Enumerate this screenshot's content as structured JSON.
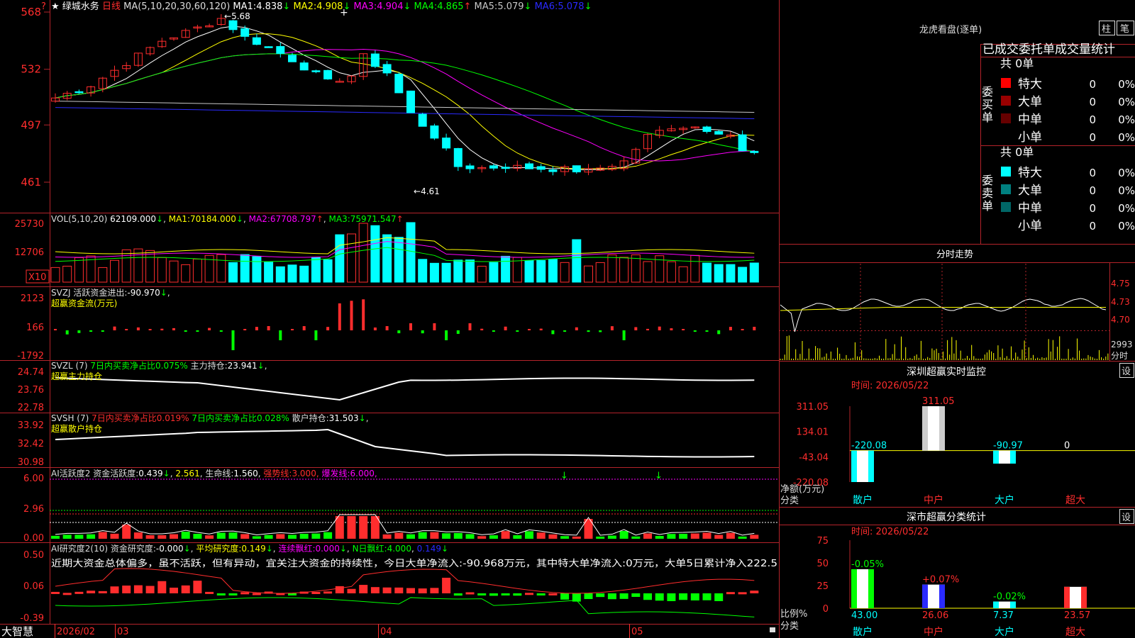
{
  "colors": {
    "up": "#ff2d2d",
    "down": "#00ffff",
    "ma1": "#ffffff",
    "ma2": "#ffff00",
    "ma3": "#ff00ff",
    "ma4": "#00ff00",
    "ma5": "#c8c8c8",
    "ma6": "#2a2aff",
    "axis": "#b4232a",
    "green": "#00ff00",
    "yellow": "#ffff00",
    "magenta": "#ff00ff"
  },
  "header": {
    "star": "★",
    "stock_name": "绿城水务",
    "period": "日线",
    "ma_params": "MA(5,10,20,30,60,120)",
    "ma": [
      {
        "label": "MA1:",
        "value": "4.838",
        "arrow": "↓"
      },
      {
        "label": "MA2:",
        "value": "4.908",
        "arrow": "↓"
      },
      {
        "label": "MA3:",
        "value": "4.904",
        "arrow": "↓"
      },
      {
        "label": "MA4:",
        "value": "4.865",
        "arrow": "↑"
      },
      {
        "label": "MA5:",
        "value": "5.079",
        "arrow": "↓"
      },
      {
        "label": "MA6:",
        "value": "5.078",
        "arrow": "↓"
      }
    ],
    "help": "?"
  },
  "main_axis": {
    "ticks": [
      "568",
      "532",
      "497",
      "461"
    ],
    "high_label": "5.68",
    "low_label": "4.61"
  },
  "vol": {
    "title": "VOL(5,10,20)",
    "value": "62109.000",
    "arrow": "↓",
    "ma": [
      {
        "label": "MA1:",
        "value": "70184.000",
        "arrow": "↓"
      },
      {
        "label": "MA2:",
        "value": "67708.797",
        "arrow": "↑"
      },
      {
        "label": "MA3:",
        "value": "75971.547",
        "arrow": "↑"
      }
    ],
    "ticks": [
      "25730",
      "12706"
    ],
    "unit": "X10"
  },
  "svzj": {
    "title": "SVZJ",
    "label": "活跃资金进出:",
    "value": "-90.970",
    "arrow": "↓",
    "subtitle": "超赢资金流(万元)",
    "ticks": [
      "2123",
      "166",
      "-1792"
    ]
  },
  "svzl": {
    "title": "SVZL (7)",
    "t1": "7日内买卖净占比0.075%",
    "t2": "主力持仓:",
    "value": "23.941",
    "arrow": "↓",
    "subtitle": "超赢主力持仓",
    "ticks": [
      "24.74",
      "23.76",
      "22.78"
    ]
  },
  "svsh": {
    "title": "SVSH (7)",
    "t1": "7日内买卖净占比0.019%",
    "t2": "7日内买卖净占比0.028%",
    "t3": "散户持仓:",
    "value": "31.503",
    "arrow": "↓",
    "subtitle": "超赢散户持仓",
    "ticks": [
      "33.92",
      "32.42",
      "30.98"
    ]
  },
  "ai_active": {
    "title": "AI活跃度2",
    "label": "资金活跃度:",
    "v1": "0.439",
    "a1": "↓",
    "v2": "2.561",
    "label2": "生命线:",
    "v3": "1.560",
    "strong": "强势线:",
    "v4": "3.000",
    "burst": "爆发线:",
    "v5": "6.000",
    "ticks": [
      "6.00",
      "2.96",
      "0.00"
    ]
  },
  "ai_research": {
    "title": "AI研究度2(10)",
    "l1": "资金研究度:",
    "v1": "-0.000",
    "a1": "↓",
    "l2": "平均研究度:",
    "v2": "0.149",
    "a2": "↓",
    "l3": "连续飘红:",
    "v3": "0.000",
    "a3": "↓",
    "l4": "N日飘红:",
    "v4": "4.000",
    "v5": "0.149",
    "a5": "↓",
    "commentary": "近期大资金总体偏多，虽不活跃，但有异动，宜关注大资金的持续性，今日大单净流入:-90.968万元，其中特大单净流入:0万元，大单5日累计净入222.5",
    "ticks": [
      "0.50",
      "0.06",
      "-0.39"
    ]
  },
  "time_axis": {
    "brand": "大智慧",
    "labels": [
      "2026/02",
      "03",
      "04",
      "05"
    ]
  },
  "right": {
    "lhkp_title": "龙虎看盘(逐单)",
    "tab_bar": "柱",
    "tab_brush": "笔",
    "stats_header": "已成交委托单成交量统计",
    "buy": {
      "side": "委买单",
      "total": "共 0单",
      "rows": [
        {
          "name": "特大",
          "count": "0",
          "pct": "0%",
          "color": "#ff0000"
        },
        {
          "name": "大单",
          "count": "0",
          "pct": "0%",
          "color": "#990000"
        },
        {
          "name": "中单",
          "count": "0",
          "pct": "0%",
          "color": "#660000"
        },
        {
          "name": "小单",
          "count": "0",
          "pct": "0%",
          "color": ""
        }
      ]
    },
    "sell": {
      "side": "委卖单",
      "total": "共 0单",
      "rows": [
        {
          "name": "特大",
          "count": "0",
          "pct": "0%",
          "color": "#00ffff"
        },
        {
          "name": "大单",
          "count": "0",
          "pct": "0%",
          "color": "#008080"
        },
        {
          "name": "中单",
          "count": "0",
          "pct": "0%",
          "color": "#006666"
        },
        {
          "name": "小单",
          "count": "0",
          "pct": "0%",
          "color": ""
        }
      ]
    },
    "intraday": {
      "title": "分时走势",
      "ticks": [
        "4.75",
        "4.73",
        "4.70"
      ],
      "vol_tick": "2993",
      "vol_label": "分时"
    },
    "monitor": {
      "title": "深圳超赢实时监控",
      "settings": "设",
      "time": "时间: 2026/05/22",
      "ticks": [
        "311.05",
        "134.01",
        "-43.04",
        "-220.08"
      ],
      "net_label": "净额(万元)",
      "cat_label": "分类",
      "bars": [
        {
          "name": "散户",
          "value": -220.08,
          "label": "-220.08",
          "color": "#00ffff"
        },
        {
          "name": "中户",
          "value": 311.05,
          "label": "311.05",
          "color": "#cccccc"
        },
        {
          "name": "大户",
          "value": -90.97,
          "label": "-90.97",
          "color": "#00ffff"
        },
        {
          "name": "超大",
          "value": 0,
          "label": "0",
          "color": "#cccccc"
        }
      ]
    },
    "classify": {
      "title": "深市超赢分类统计",
      "settings": "设",
      "time": "时间: 2026/05/22",
      "ticks": [
        "75",
        "50",
        "25",
        "0"
      ],
      "ratio_label": "比例%",
      "cat_label": "分类",
      "bars": [
        {
          "name": "散户",
          "pct": 43.0,
          "label": "43.00",
          "delta": "-0.05%",
          "color": "#00ff00",
          "delta_color": "#00ff00"
        },
        {
          "name": "中户",
          "pct": 26.06,
          "label": "26.06",
          "delta": "+0.07%",
          "color": "#2a2aff",
          "delta_color": "#ff2d2d"
        },
        {
          "name": "大户",
          "pct": 7.37,
          "label": "7.37",
          "delta": "-0.02%",
          "color": "#00ffff",
          "delta_color": "#00ff00"
        },
        {
          "name": "超大",
          "pct": 23.57,
          "label": "23.57",
          "delta": "",
          "color": "#ff2d2d",
          "delta_color": "#ff2d2d"
        }
      ]
    }
  }
}
